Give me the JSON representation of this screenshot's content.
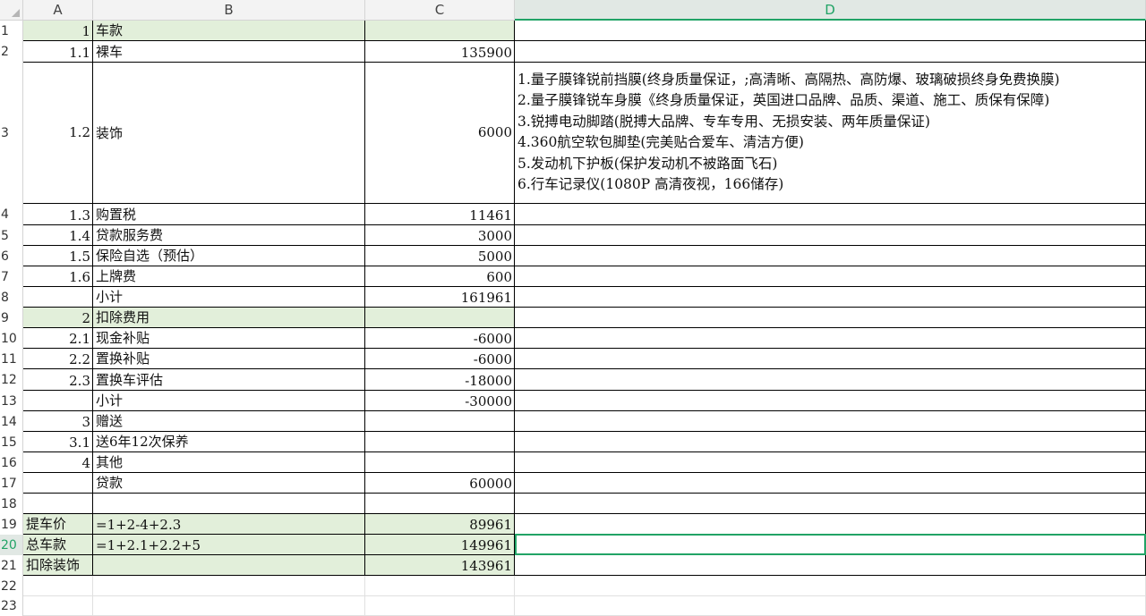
{
  "columns": [
    "A",
    "B",
    "C",
    "D"
  ],
  "active_column": "D",
  "active_row": "20",
  "row_numbers": [
    "1",
    "2",
    "3",
    "4",
    "5",
    "6",
    "7",
    "8",
    "9",
    "10",
    "11",
    "12",
    "13",
    "14",
    "15",
    "16",
    "17",
    "18",
    "19",
    "20",
    "21",
    "22",
    "23"
  ],
  "rows": [
    {
      "a": "1",
      "b": "车款",
      "c": ""
    },
    {
      "a": "1.1",
      "b": "裸车",
      "c": "135900"
    },
    {
      "a": "1.2",
      "b": "装饰",
      "c": "6000"
    },
    {
      "a": "1.3",
      "b": "购置税",
      "c": "11461"
    },
    {
      "a": "1.4",
      "b": "贷款服务费",
      "c": "3000"
    },
    {
      "a": "1.5",
      "b": "保险自选（预估）",
      "c": "5000"
    },
    {
      "a": "1.6",
      "b": "上牌费",
      "c": "600"
    },
    {
      "a": "",
      "b": "小计",
      "c": "161961"
    },
    {
      "a": "2",
      "b": "扣除费用",
      "c": ""
    },
    {
      "a": "2.1",
      "b": "现金补贴",
      "c": "-6000"
    },
    {
      "a": "2.2",
      "b": "置换补贴",
      "c": "-6000"
    },
    {
      "a": "2.3",
      "b": "置换车评估",
      "c": "-18000"
    },
    {
      "a": "",
      "b": "小计",
      "c": "-30000"
    },
    {
      "a": "3",
      "b": "赠送",
      "c": ""
    },
    {
      "a": "3.1",
      "b": "送6年12次保养",
      "c": ""
    },
    {
      "a": "4",
      "b": "其他",
      "c": ""
    },
    {
      "a": "",
      "b": "贷款",
      "c": "60000"
    },
    {
      "a": "",
      "b": "",
      "c": ""
    },
    {
      "a": "提车价",
      "b": "=1+2-4+2.3",
      "c": "89961"
    },
    {
      "a": "总车款",
      "b": "=1+2.1+2.2+5",
      "c": "149961"
    },
    {
      "a": "扣除装饰",
      "b": "",
      "c": "143961"
    }
  ],
  "decoration_list": [
    "1.量子膜锋锐前挡膜(终身质量保证，;高清晰、高隔热、高防爆、玻璃破损终身免费换膜)",
    "2.量子膜锋锐车身膜《终身质量保证，英国进口品牌、品质、渠道、施工、质保有保障)",
    "3.锐搏电动脚踏(脱搏大品牌、专车专用、无损安装、两年质量保证)",
    "4.360航空软包脚垫(完美贴合爱车、清洁方便)",
    "5.发动机下护板(保护发动机不被路面飞石)",
    "6.行车记录仪(1080P 高清夜视，166储存)"
  ],
  "colors": {
    "header_bg": "#f3f3f3",
    "accent_green": "#21a366",
    "section_fill": "#e2efda"
  }
}
